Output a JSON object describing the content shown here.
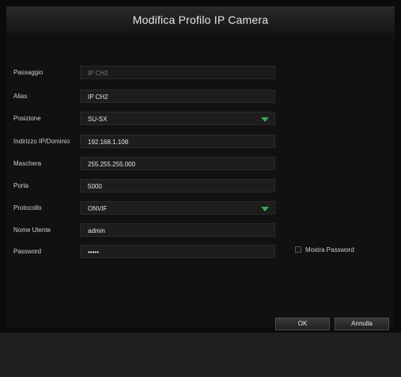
{
  "dialog": {
    "title": "Modifica Profilo IP Camera"
  },
  "form": {
    "channel": {
      "label": "Passaggio",
      "value": "IP CH2"
    },
    "alias": {
      "label": "Alias",
      "value": "IP CH2"
    },
    "position": {
      "label": "Posizione",
      "value": "SU-SX"
    },
    "ip_address": {
      "label": "Indirizzo IP/Dominio",
      "value": "192.168.1.108"
    },
    "subnet": {
      "label": "Maschera",
      "value": "255.255.255.000"
    },
    "port": {
      "label": "Porta",
      "value": "5000"
    },
    "protocol": {
      "label": "Protocollo",
      "value": "ONVIF"
    },
    "username": {
      "label": "Nome Utente",
      "value": "admin"
    },
    "password": {
      "label": "Password",
      "value": "•••••"
    },
    "show_password": {
      "label": "Mostra Password",
      "checked": false
    }
  },
  "buttons": {
    "ok": "OK",
    "cancel": "Annulla"
  },
  "colors": {
    "accent": "#3aa65a",
    "background": "#111111",
    "field": "#1d1d1d"
  },
  "icons": {
    "dropdown": "chevron-down-icon"
  }
}
